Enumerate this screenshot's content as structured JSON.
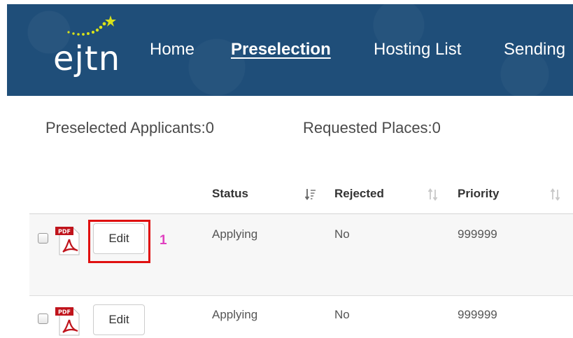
{
  "header": {
    "logo_text": "ejtn",
    "nav": {
      "home": "Home",
      "preselection": "Preselection",
      "hosting_list": "Hosting List",
      "sending": "Sending"
    },
    "bg_color": "#1f4e79"
  },
  "summary": {
    "preselected": "Preselected Applicants:0",
    "requested": "Requested Places:0"
  },
  "table": {
    "columns": [
      "Status",
      "Rejected",
      "Priority"
    ],
    "rows": [
      {
        "edit_label": "Edit",
        "status": "Applying",
        "rejected": "No",
        "priority": "999999",
        "marker": "1"
      },
      {
        "edit_label": "Edit",
        "status": "Applying",
        "rejected": "No",
        "priority": "999999"
      }
    ]
  },
  "icons": [
    "pdf-icon",
    "sort-icon",
    "checkbox"
  ],
  "colors": {
    "highlight": "#e01010",
    "marker": "#e040c0"
  }
}
